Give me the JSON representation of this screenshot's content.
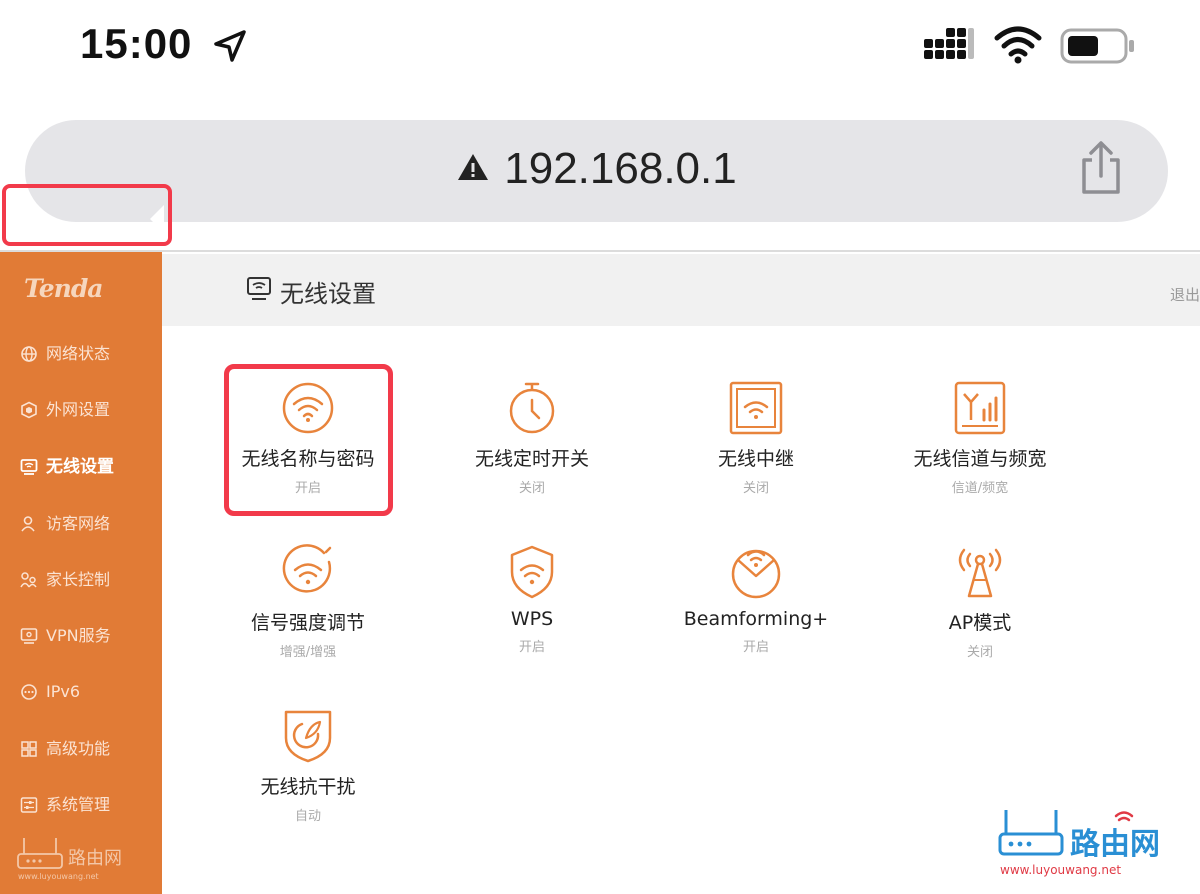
{
  "status_bar": {
    "time": "15:00",
    "location_icon": "location-arrow-icon",
    "cellular_icon": "cellular-signal-icon",
    "wifi_icon": "wifi-icon",
    "battery_icon": "battery-icon"
  },
  "browser": {
    "url": "192.168.0.1",
    "warning_icon": "warning-triangle-icon",
    "share_icon": "share-icon"
  },
  "sidebar": {
    "logo": "Tenda",
    "items": [
      {
        "label": "网络状态",
        "icon": "globe-icon"
      },
      {
        "label": "外网设置",
        "icon": "cube-icon"
      },
      {
        "label": "无线设置",
        "icon": "wifi-monitor-icon",
        "active": true
      },
      {
        "label": "访客网络",
        "icon": "guest-user-icon"
      },
      {
        "label": "家长控制",
        "icon": "family-icon"
      },
      {
        "label": "VPN服务",
        "icon": "vpn-monitor-icon"
      },
      {
        "label": "IPv6",
        "icon": "ipv6-icon"
      },
      {
        "label": "高级功能",
        "icon": "grid-icon"
      },
      {
        "label": "系统管理",
        "icon": "settings-panel-icon"
      }
    ],
    "watermark": {
      "brand": "路由网",
      "url": "www.luyouwang.net"
    }
  },
  "header": {
    "title": "无线设置",
    "logout": "退出"
  },
  "features": [
    {
      "label": "无线名称与密码",
      "status": "开启",
      "icon": "wifi-circle-icon"
    },
    {
      "label": "无线定时开关",
      "status": "关闭",
      "icon": "timer-icon"
    },
    {
      "label": "无线中继",
      "status": "关闭",
      "icon": "wifi-relay-icon"
    },
    {
      "label": "无线信道与频宽",
      "status": "信道/频宽",
      "icon": "channel-bandwidth-icon"
    },
    {
      "label": "信号强度调节",
      "status": "增强/增强",
      "icon": "signal-strength-icon"
    },
    {
      "label": "WPS",
      "status": "开启",
      "icon": "wps-shield-icon"
    },
    {
      "label": "Beamforming+",
      "status": "开启",
      "icon": "beamforming-icon"
    },
    {
      "label": "AP模式",
      "status": "关闭",
      "icon": "ap-antenna-icon"
    },
    {
      "label": "无线抗干扰",
      "status": "自动",
      "icon": "anti-interference-icon"
    }
  ],
  "watermark": {
    "brand": "路由网",
    "url": "www.luyouwang.net"
  },
  "colors": {
    "accent": "#e17b36",
    "highlight": "#f23a4a",
    "icon": "#e8843c"
  }
}
